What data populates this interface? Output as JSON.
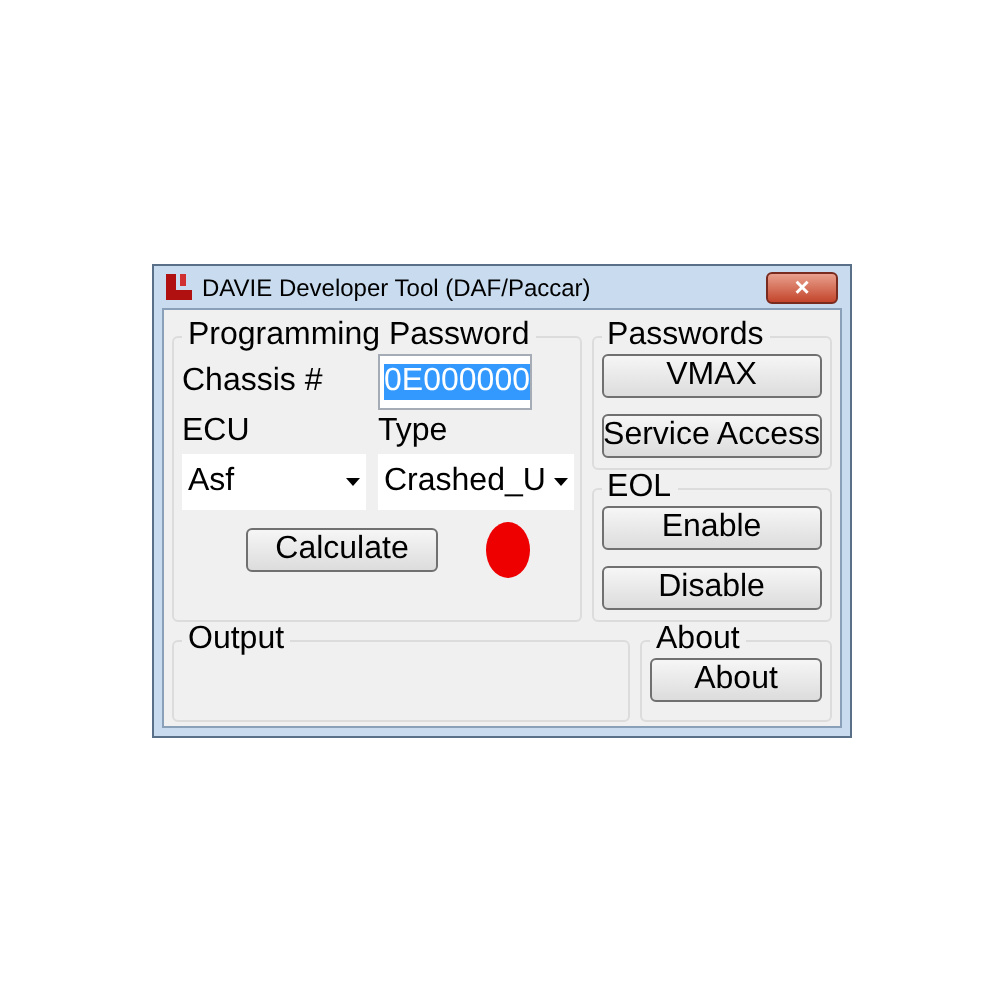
{
  "window": {
    "title": "DAVIE Developer Tool (DAF/Paccar)",
    "close": "×"
  },
  "programming": {
    "title": "Programming Password",
    "chassis_label": "Chassis #",
    "chassis_value": "0E000000",
    "chassis_text_selected": true,
    "ecu_label": "ECU",
    "type_label": "Type",
    "ecu_value": "Asf",
    "type_value": "Crashed_U",
    "calculate": "Calculate",
    "status_dot": {
      "color": "#ee0000"
    }
  },
  "passwords": {
    "title": "Passwords",
    "buttons": [
      "VMAX",
      "Service Access"
    ]
  },
  "eol": {
    "title": "EOL",
    "buttons": [
      "Enable",
      "Disable"
    ]
  },
  "output": {
    "title": "Output"
  },
  "about": {
    "title": "About",
    "button": "About"
  }
}
